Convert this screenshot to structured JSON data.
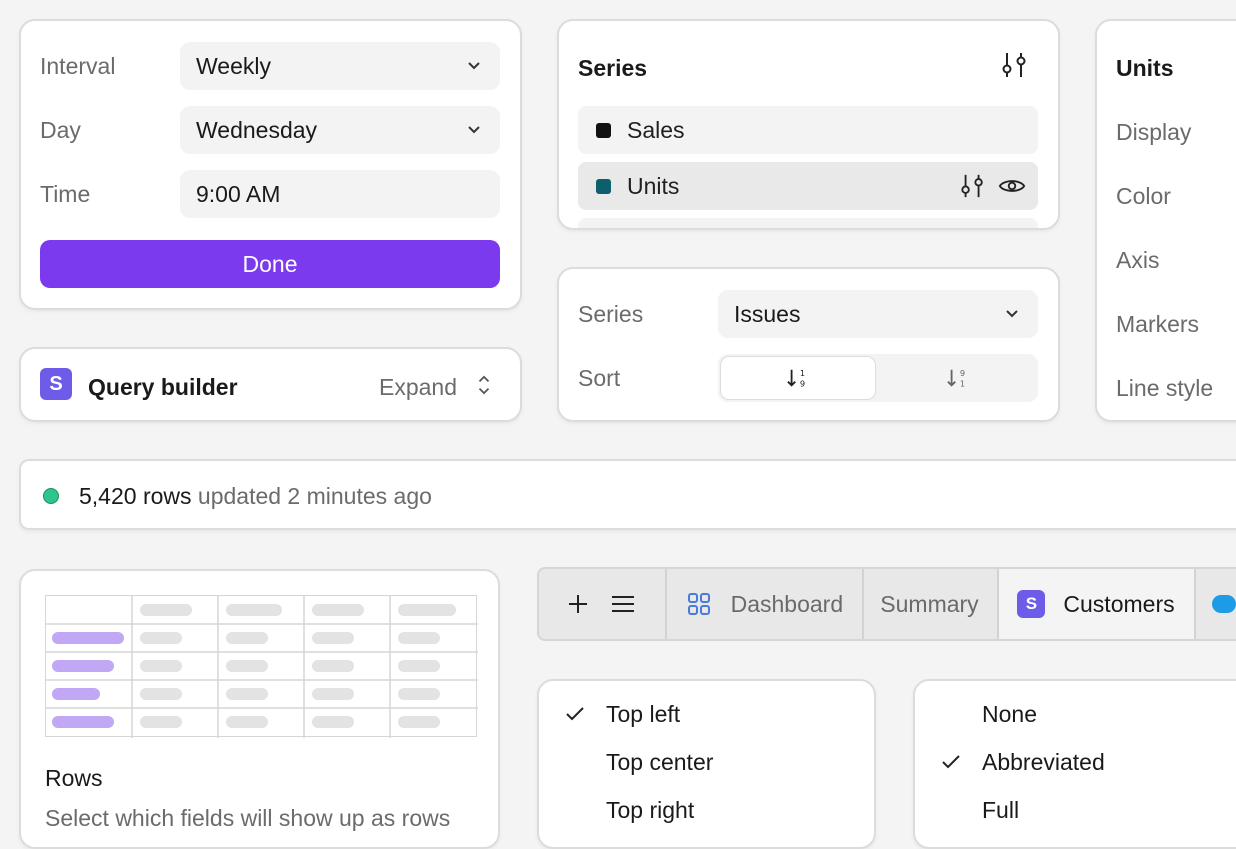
{
  "schedule": {
    "interval_label": "Interval",
    "interval_value": "Weekly",
    "day_label": "Day",
    "day_value": "Wednesday",
    "time_label": "Time",
    "time_value": "9:00 AM",
    "done_label": "Done"
  },
  "series_panel": {
    "title": "Series",
    "items": [
      {
        "label": "Sales",
        "color": "#111111"
      },
      {
        "label": "Units",
        "color": "#0e5f6e"
      }
    ]
  },
  "series_sort": {
    "series_label": "Series",
    "series_value": "Issues",
    "sort_label": "Sort"
  },
  "units_panel": {
    "title": "Units",
    "rows": [
      "Display",
      "Color",
      "Axis",
      "Markers",
      "Line style"
    ]
  },
  "query": {
    "logo_letter": "S",
    "title": "Query builder",
    "expand_label": "Expand"
  },
  "status": {
    "count": "5,420 rows",
    "suffix": "updated 2 minutes ago",
    "dot_color": "#2fc48d"
  },
  "rows_card": {
    "title": "Rows",
    "description": "Select which fields will show up as rows"
  },
  "tabs": {
    "items": [
      {
        "label": "Dashboard"
      },
      {
        "label": "Summary"
      },
      {
        "label": "Customers",
        "logo_letter": "S"
      }
    ]
  },
  "position_menu": {
    "items": [
      "Top left",
      "Top center",
      "Top right"
    ],
    "checked_index": 0
  },
  "format_menu": {
    "items": [
      "None",
      "Abbreviated",
      "Full"
    ],
    "checked_index": 1
  },
  "colors": {
    "accent": "#7b3aed",
    "logo": "#6c5ce7"
  }
}
